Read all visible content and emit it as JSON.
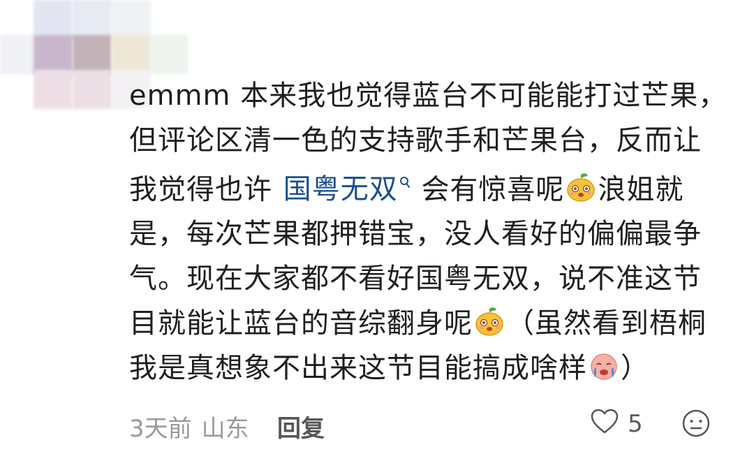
{
  "comment": {
    "segments": {
      "s1": "emmm 本来我也觉得蓝台不可能能打过芒果，但评论区清一色的支持歌手和芒果台，反而让我觉得也许",
      "topic": "国粤无双",
      "s2": "会有惊喜呢",
      "s3": "浪姐就是，每次芒果都押错宝，没人看好的偏偏最争气。现在大家都不看好国粤无双，说不准这节目就能让蓝台的音综翻身呢",
      "s4": "（虽然看到梧桐我是真想象不出来这节目能搞成啥样",
      "s5": "）"
    },
    "topic_icon": "search-icon",
    "emojis": [
      "mango-emoji",
      "mango-emoji",
      "crying-face-emoji"
    ]
  },
  "footer": {
    "time": "3天前",
    "location": "山东",
    "reply_label": "回复",
    "like_icon": "heart-icon",
    "like_count": "5",
    "reaction_icon": "smiley-icon"
  },
  "colors": {
    "text": "#1f1f1f",
    "link": "#1c4f8f",
    "meta": "#9a9a9a"
  }
}
